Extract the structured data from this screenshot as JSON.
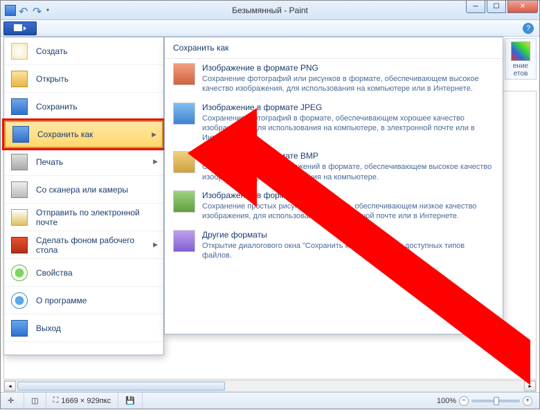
{
  "window": {
    "title": "Безымянный - Paint"
  },
  "menu": {
    "items": [
      {
        "label": "Создать",
        "has_arrow": false
      },
      {
        "label": "Открыть",
        "has_arrow": false
      },
      {
        "label": "Сохранить",
        "has_arrow": false
      },
      {
        "label": "Сохранить как",
        "has_arrow": true
      },
      {
        "label": "Печать",
        "has_arrow": true
      },
      {
        "label": "Со сканера или камеры",
        "has_arrow": false
      },
      {
        "label": "Отправить по электронной почте",
        "has_arrow": false
      },
      {
        "label": "Сделать фоном рабочего стола",
        "has_arrow": true
      },
      {
        "label": "Свойства",
        "has_arrow": false
      },
      {
        "label": "О программе",
        "has_arrow": false
      },
      {
        "label": "Выход",
        "has_arrow": false
      }
    ]
  },
  "submenu": {
    "header": "Сохранить как",
    "items": [
      {
        "title": "Изображение в формате PNG",
        "desc": "Сохранение фотографий или рисунков в формате, обеспечивающем высокое качество изображения, для использования на компьютере или в Интернете."
      },
      {
        "title": "Изображение в формате JPEG",
        "desc": "Сохранение фотографий в формате, обеспечивающем хорошее качество изображения, для использования на компьютере, в электронной почте или в Интернете."
      },
      {
        "title": "Изображение в формате BMP",
        "desc": "Сохранение любых изображений в формате, обеспечивающем высокое качество изображения, для использования на компьютере."
      },
      {
        "title": "Изображение в формате GIF",
        "desc": "Сохранение простых рисунков в формате, обеспечивающем низкое качество изображения, для использования в электронной почте или в Интернете."
      },
      {
        "title": "Другие форматы",
        "desc": "Открытие диалогового окна \"Сохранить как\" для выбора доступных типов файлов."
      }
    ]
  },
  "right_panel": {
    "label1": "ение",
    "label2": "етов"
  },
  "statusbar": {
    "coords": "",
    "size": "1669 × 929пкс",
    "zoom": "100%"
  }
}
